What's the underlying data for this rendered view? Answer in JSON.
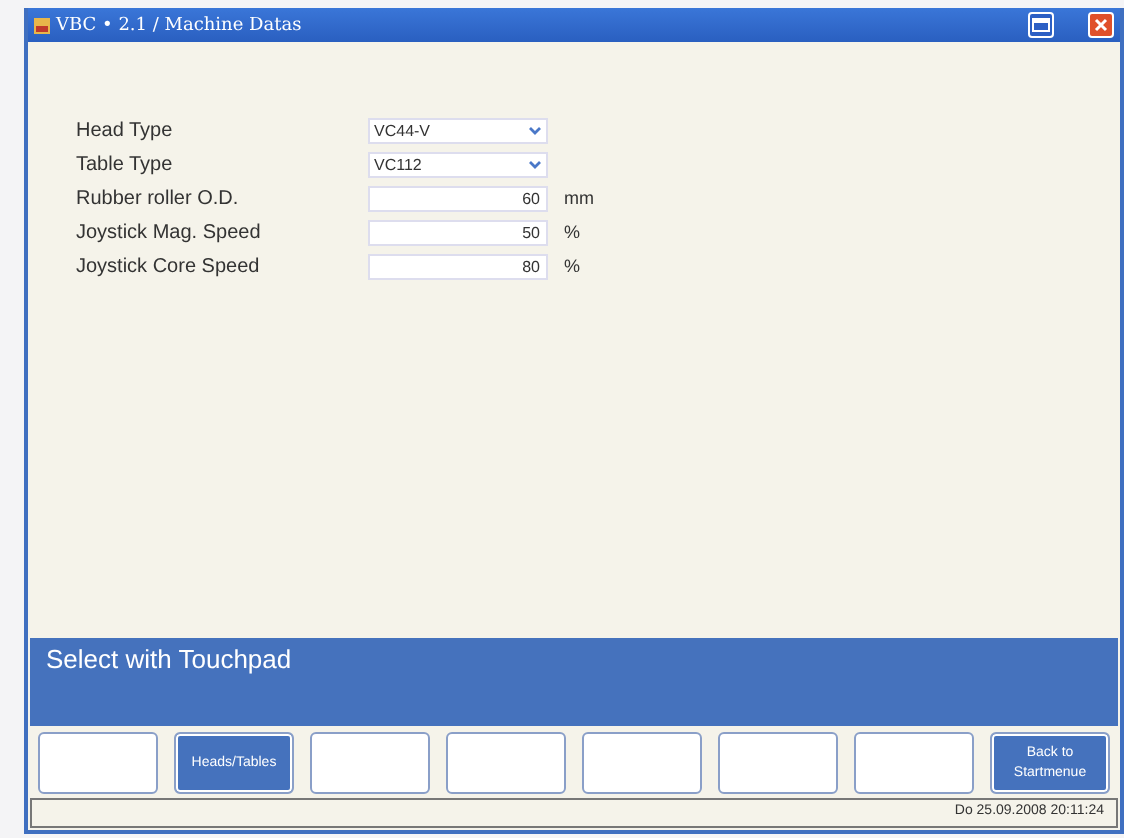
{
  "window": {
    "title": "VBC  • 2.1 / Machine Datas"
  },
  "fields": [
    {
      "kind": "dropdown",
      "label": "Head Type",
      "value": "VC44-V"
    },
    {
      "kind": "dropdown",
      "label": "Table Type",
      "value": "VC112"
    },
    {
      "kind": "number",
      "label": "Rubber roller O.D.",
      "value": "60",
      "unit": "mm"
    },
    {
      "kind": "number",
      "label": "Joystick Mag. Speed",
      "value": "50",
      "unit": "%"
    },
    {
      "kind": "number",
      "label": "Joystick Core Speed",
      "value": "80",
      "unit": "%"
    }
  ],
  "message": "Select with Touchpad",
  "buttons": [
    {
      "filled": false
    },
    {
      "filled": true,
      "label": "Heads/Tables"
    },
    {
      "filled": false
    },
    {
      "filled": false
    },
    {
      "filled": false
    },
    {
      "filled": false
    },
    {
      "filled": false
    },
    {
      "filled": true,
      "label": "Back to Startmenue"
    }
  ],
  "status_bar": "Do 25.09.2008 20:11:24"
}
